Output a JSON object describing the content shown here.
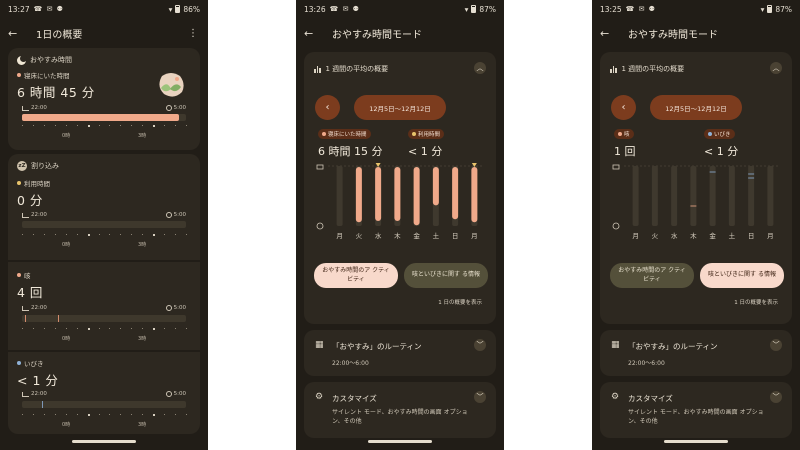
{
  "screen1": {
    "status": {
      "time": "13:27",
      "icons": "☎ ✉ ⚉",
      "battery": "86%"
    },
    "title": "1日の概要",
    "sleep": {
      "section": "おやすみ時間",
      "label": "寝床にいた時間",
      "value": "6 時間 45 分",
      "start": "22:00",
      "end": "5:00",
      "tick_labels": [
        "0時",
        "3時"
      ],
      "fill_fraction": 0.96
    },
    "interruptions": {
      "section": "割り込み",
      "label": "利用時間",
      "value": "0 分",
      "start": "22:00",
      "end": "5:00",
      "tick_labels": [
        "0時",
        "3時"
      ]
    },
    "cough": {
      "label": "咳",
      "value": "4 回",
      "start": "22:00",
      "end": "5:00",
      "tick_labels": [
        "0時",
        "3時"
      ]
    },
    "snore": {
      "label": "いびき",
      "value": "< 1 分",
      "start": "22:00",
      "end": "5:00",
      "tick_labels": [
        "0時",
        "3時"
      ]
    }
  },
  "screen2": {
    "status": {
      "time": "13:26",
      "icons": "☎ ✉ ⚉",
      "battery": "87%"
    },
    "title": "おやすみ時間モード",
    "weekly_title": "1 週間の平均の概要",
    "range": "12月5日～12月12日",
    "chip1": "寝床にいた時間",
    "chip2": "利用時間",
    "value1": "6 時間 15 分",
    "value2": "< 1 分",
    "days": [
      "月",
      "火",
      "水",
      "木",
      "金",
      "土",
      "日",
      "月"
    ],
    "btn_activity": "おやすみ時間のア クティビティ",
    "btn_cough_info": "咳といびきに関す る情報",
    "show_daily": "1 日の概要を表示",
    "routine_title": "「おやすみ」のルーティン",
    "routine_time": "22:00～6:00",
    "custom_title": "カスタマイズ",
    "custom_sub": "サイレント モード、おやすみ時間の画面 オプション、その他"
  },
  "screen3": {
    "status": {
      "time": "13:25",
      "icons": "☎ ✉ ⚉",
      "battery": "87%"
    },
    "title": "おやすみ時間モード",
    "weekly_title": "1 週間の平均の概要",
    "range": "12月5日～12月12日",
    "chip1": "咳",
    "chip2": "いびき",
    "value1": "1 回",
    "value2": "< 1 分",
    "days": [
      "月",
      "火",
      "水",
      "木",
      "金",
      "土",
      "日",
      "月"
    ],
    "btn_activity": "おやすみ時間のア クティビティ",
    "btn_cough_info": "咳といびきに関す る情報",
    "show_daily": "1 日の概要を表示",
    "routine_title": "「おやすみ」のルーティン",
    "routine_time": "22:00～6:00",
    "custom_title": "カスタマイズ",
    "custom_sub": "サイレント モード、おやすみ時間の画面 オプション、その他"
  },
  "colors": {
    "background": "#211d17",
    "card": "#2d2820",
    "accent": "#f0a98a",
    "pill": "#7c3c1e",
    "chip": "#5b2e18",
    "snore_dot": "#8fb1d6",
    "usage_dot": "#e7c36b"
  },
  "chart_data": [
    {
      "type": "bar",
      "categories": [
        "月",
        "火",
        "水",
        "木",
        "金",
        "土",
        "日",
        "月"
      ],
      "series": [
        {
          "name": "寝床にいた時間",
          "values": [
            0.0,
            0.92,
            0.9,
            0.9,
            0.97,
            0.64,
            0.87,
            0.92
          ]
        }
      ]
    },
    {
      "type": "bar",
      "categories": [
        "月",
        "火",
        "水",
        "木",
        "金",
        "土",
        "日",
        "月"
      ],
      "series": [
        {
          "name": "咳",
          "values": [
            0,
            0,
            0,
            1,
            0,
            0,
            0,
            0
          ]
        }
      ]
    }
  ]
}
